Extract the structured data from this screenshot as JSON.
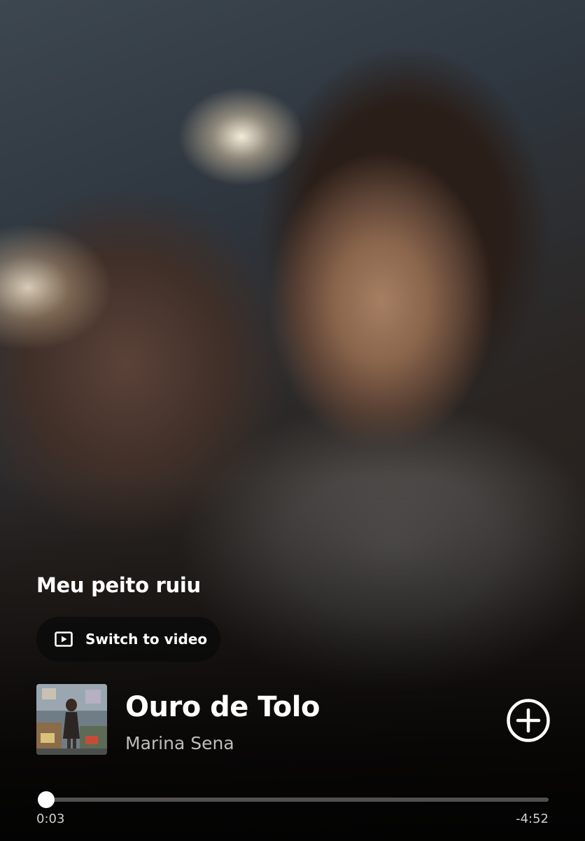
{
  "canvas": {
    "title": "Meu peito ruiu",
    "switch_label": "Switch to video"
  },
  "track": {
    "title": "Ouro de Tolo",
    "artist": "Marina Sena"
  },
  "playback": {
    "elapsed": "0:03",
    "remaining": "-4:52",
    "progress_fraction": 0.01
  },
  "icons": {
    "switch": "play-video-icon",
    "add": "plus-circle-icon"
  },
  "colors": {
    "accent": "#ffffff",
    "secondary_text": "#bdbdbd"
  }
}
